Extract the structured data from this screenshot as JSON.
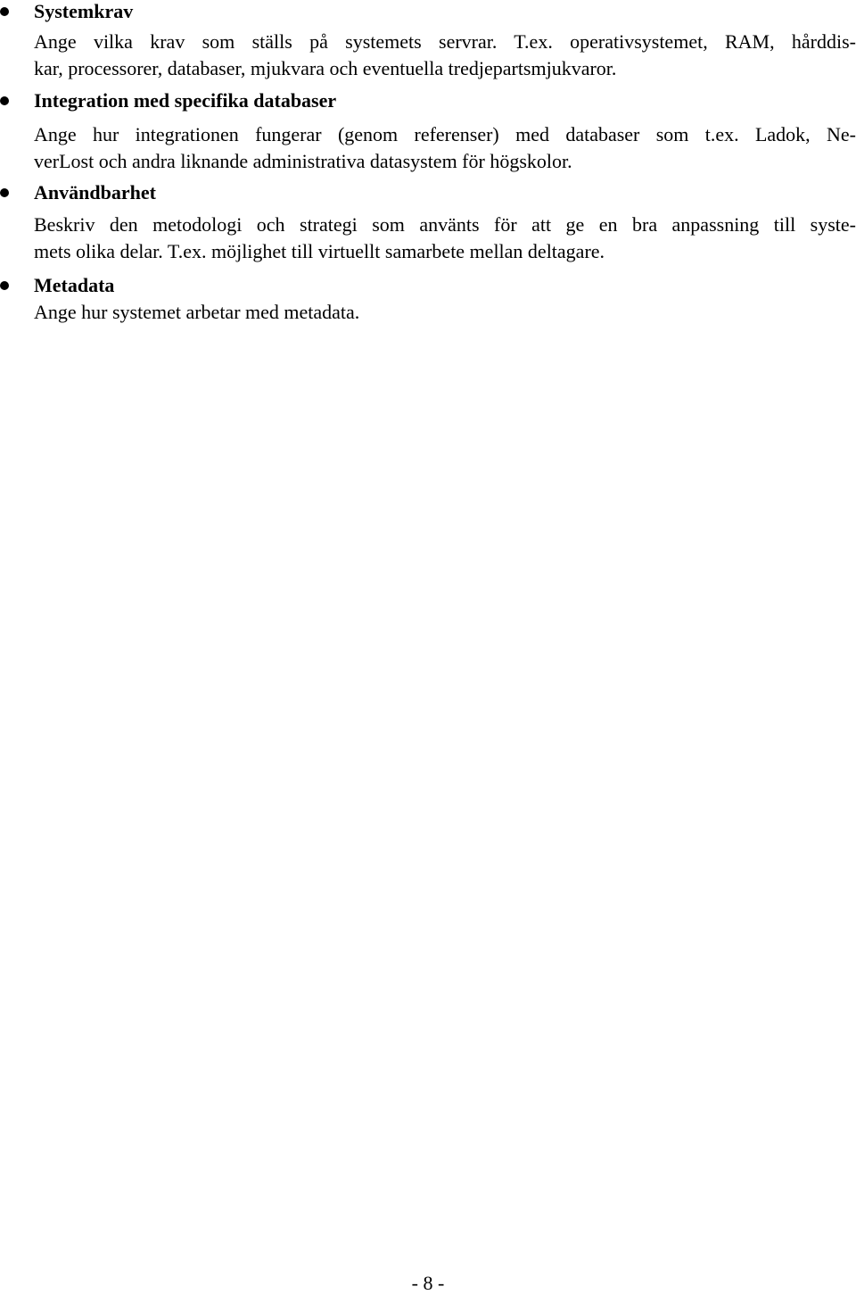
{
  "sections": [
    {
      "heading": "Systemkrav",
      "lines": [
        "Ange vilka krav som ställs på systemets servrar. T.ex. operativsystemet, RAM, hårddis-",
        "kar, processorer, databaser, mjukvara och eventuella tredjepartsmjukvaror."
      ]
    },
    {
      "heading": "Integration med specifika databaser",
      "lines": [
        "Ange hur integrationen fungerar (genom referenser) med databaser som t.ex. Ladok, Ne-",
        "verLost och andra liknande administrativa datasystem för högskolor."
      ]
    },
    {
      "heading": "Användbarhet",
      "lines": [
        "Beskriv den metodologi och strategi som använts för att ge en bra anpassning till syste-",
        "mets olika delar. T.ex. möjlighet till virtuellt samarbete mellan deltagare."
      ]
    },
    {
      "heading": "Metadata",
      "lines": [
        "Ange hur systemet arbetar med metadata."
      ]
    }
  ],
  "footer": {
    "page_number": "- 8 -"
  }
}
